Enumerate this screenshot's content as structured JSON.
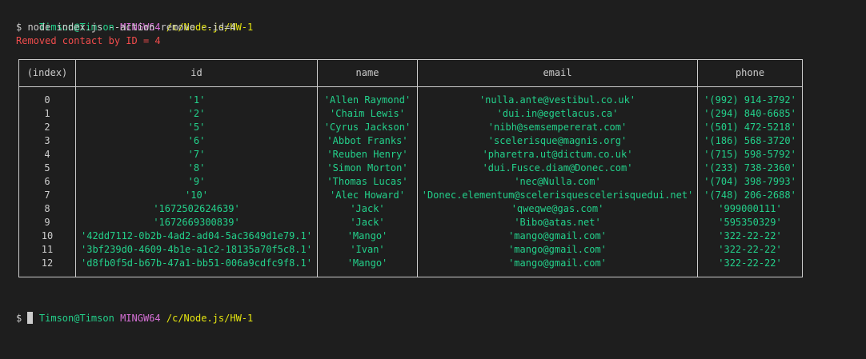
{
  "prompt1": {
    "user": "Timson@Timson",
    "system": "MINGW64",
    "path": "/c/Node.js/HW-1"
  },
  "command_line": "$ node index.js --action remove --id=4",
  "output_message": "Removed contact by ID = 4",
  "table": {
    "headers": [
      "(index)",
      "id",
      "name",
      "email",
      "phone"
    ],
    "rows": [
      {
        "index": "0",
        "id": "'1'",
        "name": "'Allen Raymond'",
        "email": "'nulla.ante@vestibul.co.uk'",
        "phone": "'(992) 914-3792'"
      },
      {
        "index": "1",
        "id": "'2'",
        "name": "'Chaim Lewis'",
        "email": "'dui.in@egetlacus.ca'",
        "phone": "'(294) 840-6685'"
      },
      {
        "index": "2",
        "id": "'5'",
        "name": "'Cyrus Jackson'",
        "email": "'nibh@semsempererat.com'",
        "phone": "'(501) 472-5218'"
      },
      {
        "index": "3",
        "id": "'6'",
        "name": "'Abbot Franks'",
        "email": "'scelerisque@magnis.org'",
        "phone": "'(186) 568-3720'"
      },
      {
        "index": "4",
        "id": "'7'",
        "name": "'Reuben Henry'",
        "email": "'pharetra.ut@dictum.co.uk'",
        "phone": "'(715) 598-5792'"
      },
      {
        "index": "5",
        "id": "'8'",
        "name": "'Simon Morton'",
        "email": "'dui.Fusce.diam@Donec.com'",
        "phone": "'(233) 738-2360'"
      },
      {
        "index": "6",
        "id": "'9'",
        "name": "'Thomas Lucas'",
        "email": "'nec@Nulla.com'",
        "phone": "'(704) 398-7993'"
      },
      {
        "index": "7",
        "id": "'10'",
        "name": "'Alec Howard'",
        "email": "'Donec.elementum@scelerisquescelerisquedui.net'",
        "phone": "'(748) 206-2688'"
      },
      {
        "index": "8",
        "id": "'1672502624639'",
        "name": "'Jack'",
        "email": "'qweqwe@gas.com'",
        "phone": "'999000111'"
      },
      {
        "index": "9",
        "id": "'1672669300839'",
        "name": "'Jack'",
        "email": "'Bibo@atas.net'",
        "phone": "'595350329'"
      },
      {
        "index": "10",
        "id": "'42dd7112-0b2b-4ad2-ad04-5ac3649d1e79.1'",
        "name": "'Mango'",
        "email": "'mango@gmail.com'",
        "phone": "'322-22-22'"
      },
      {
        "index": "11",
        "id": "'3bf239d0-4609-4b1e-a1c2-18135a70f5c8.1'",
        "name": "'Ivan'",
        "email": "'mango@gmail.com'",
        "phone": "'322-22-22'"
      },
      {
        "index": "12",
        "id": "'d8fb0f5d-b67b-47a1-bb51-006a9cdfc9f8.1'",
        "name": "'Mango'",
        "email": "'mango@gmail.com'",
        "phone": "'322-22-22'"
      }
    ]
  },
  "prompt2": {
    "user": "Timson@Timson",
    "system": "MINGW64",
    "path": "/c/Node.js/HW-1"
  },
  "input_prompt": "$ ",
  "colors": {
    "background": "#1e1e1e",
    "user": "#23d18b",
    "system": "#d670d6",
    "path": "#e5e510",
    "error": "#f14c4c",
    "string_value": "#23d18b",
    "text": "#cccccc"
  }
}
